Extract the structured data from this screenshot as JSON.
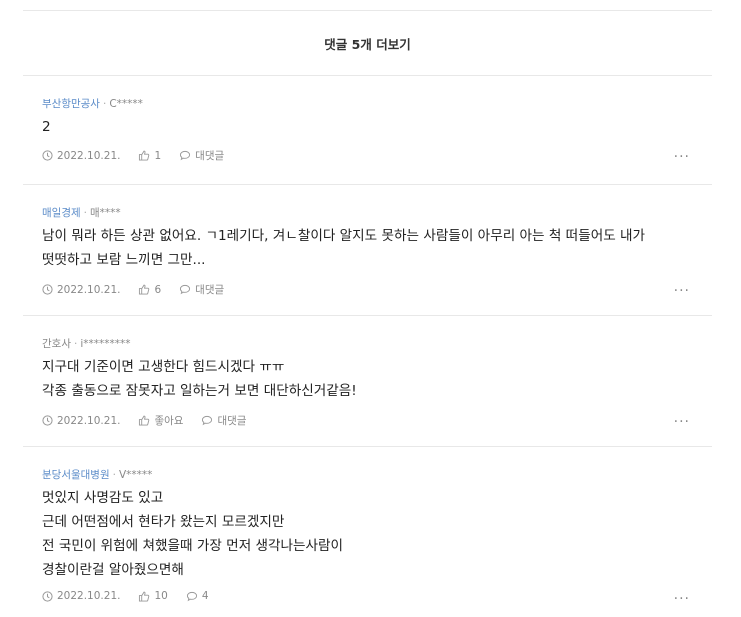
{
  "more_comments_label": "댓글 5개 더보기",
  "comments": [
    {
      "author": "부산항만공사",
      "user": "C*****",
      "text": "2",
      "date": "2022.10.21.",
      "likes": "1",
      "reply": "대댓글"
    },
    {
      "author": "매일경제",
      "user": "매****",
      "text": "남이 뭐라 하든 상관 없어요. ㄱ1레기다, 겨ㄴ찰이다 알지도 못하는 사람들이 아무리 아는 척 떠들어도 내가\n떳떳하고 보람 느끼면 그만...",
      "date": "2022.10.21.",
      "likes": "6",
      "reply": "대댓글"
    },
    {
      "author": "간호사",
      "user": "i*********",
      "text": "지구대 기준이면 고생한다 힘드시겠다 ㅠㅠ\n각종 출동으로 잠못자고 일하는거 보면 대단하신거같음!",
      "date": "2022.10.21.",
      "likes": "좋아요",
      "reply": "대댓글"
    },
    {
      "author": "분당서울대병원",
      "user": "V*****",
      "text": "멋있지 사명감도 있고\n근데 어떤점에서 현타가 왔는지 모르겠지만\n전 국민이 위험에 쳐했을때 가장 먼저 생각나는사람이\n경찰이란걸 알아줬으면해",
      "date": "2022.10.21.",
      "likes": "10",
      "reply": "4"
    }
  ],
  "more_icon_label": "···"
}
